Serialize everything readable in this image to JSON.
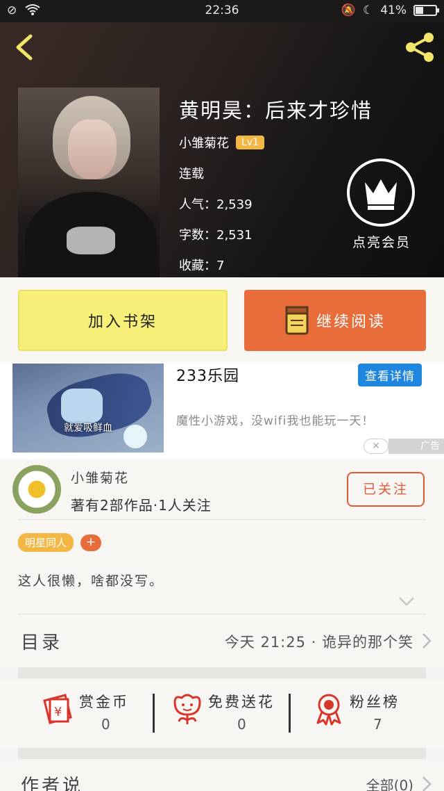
{
  "status_bar": {
    "time": "22:36",
    "battery": "41%"
  },
  "book": {
    "title": "黄明昊：后来才珍惜",
    "author": "小雏菊花",
    "level": "Lv1",
    "status": "连载",
    "popularity_label": "人气：",
    "popularity": "2,539",
    "word_count_label": "字数：",
    "word_count": "2,531",
    "favorites_label": "收藏：",
    "favorites": "7"
  },
  "vip": {
    "label": "点亮会员"
  },
  "actions": {
    "add_shelf": "加入书架",
    "continue_reading": "继续阅读"
  },
  "ad": {
    "title": "233乐园",
    "detail_button": "查看详情",
    "description": "魔性小游戏，没wifi我也能玩一天！",
    "image_caption": "就爱吸鲜血",
    "close": "✕",
    "tag": "广告"
  },
  "author_section": {
    "name": "小雏菊花",
    "works": "著有2部作品·1人关注",
    "follow_button": "已关注",
    "tag": "明星同人",
    "tag_add": "+",
    "intro": "这人很懒，啥都没写。"
  },
  "catalog": {
    "label": "目录",
    "latest": "今天 21:25 · 诡异的那个笑"
  },
  "stats": [
    {
      "title": "赏金币",
      "value": "0"
    },
    {
      "title": "免费送花",
      "value": "0"
    },
    {
      "title": "粉丝榜",
      "value": "7"
    }
  ],
  "author_says": {
    "label": "作者说",
    "all": "全部(0)"
  },
  "colors": {
    "accent_orange": "#e86d3b",
    "accent_yellow": "#f8ef79",
    "badge_gold": "#f3b745",
    "link_blue": "#1f86e0"
  }
}
